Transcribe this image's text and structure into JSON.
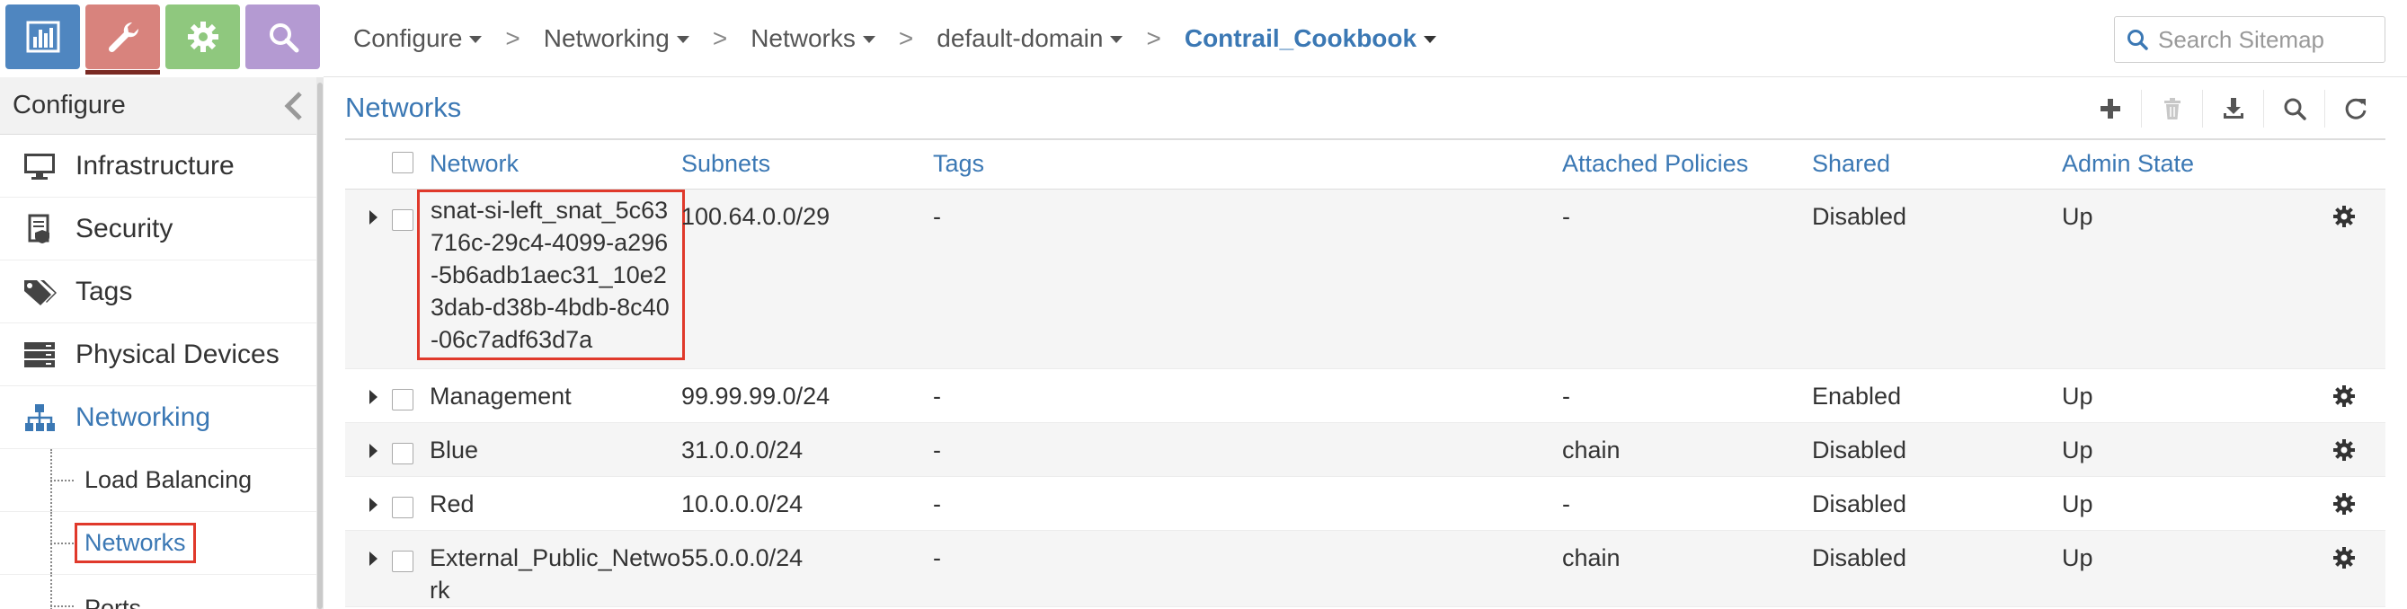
{
  "nav": {
    "tabs": [
      {
        "name": "monitor",
        "icon": "bar-chart-icon",
        "color": "#4f86c0"
      },
      {
        "name": "configure",
        "icon": "wrench-icon",
        "color": "#d8837d"
      },
      {
        "name": "settings",
        "icon": "gear-icon",
        "color": "#8fc87e"
      },
      {
        "name": "query",
        "icon": "search-icon",
        "color": "#b49ad2"
      }
    ]
  },
  "breadcrumb": [
    {
      "label": "Configure"
    },
    {
      "label": "Networking"
    },
    {
      "label": "Networks"
    },
    {
      "label": "default-domain"
    },
    {
      "label": "Contrail_Cookbook"
    }
  ],
  "search": {
    "placeholder": "Search Sitemap"
  },
  "sidebar": {
    "header": "Configure",
    "items": [
      {
        "label": "Infrastructure",
        "icon": "monitor-icon"
      },
      {
        "label": "Security",
        "icon": "security-doc-icon"
      },
      {
        "label": "Tags",
        "icon": "tags-icon"
      },
      {
        "label": "Physical Devices",
        "icon": "server-icon"
      },
      {
        "label": "Networking",
        "icon": "network-tree-icon"
      }
    ],
    "subitems": [
      {
        "label": "Load Balancing"
      },
      {
        "label": "Networks"
      },
      {
        "label": "Ports"
      }
    ]
  },
  "main": {
    "title": "Networks",
    "columns": [
      "Network",
      "Subnets",
      "Tags",
      "Attached Policies",
      "Shared",
      "Admin State"
    ],
    "rows": [
      {
        "network": "snat-si-left_snat_5c63716c-29c4-4099-a296-5b6adb1aec31_10e23dab-d38b-4bdb-8c40-06c7adf63d7a",
        "subnets": "100.64.0.0/29",
        "tags": "-",
        "policies": "-",
        "shared": "Disabled",
        "admin_state": "Up"
      },
      {
        "network": "Management",
        "subnets": "99.99.99.0/24",
        "tags": "-",
        "policies": "-",
        "shared": "Enabled",
        "admin_state": "Up"
      },
      {
        "network": "Blue",
        "subnets": "31.0.0.0/24",
        "tags": "-",
        "policies": "chain",
        "shared": "Disabled",
        "admin_state": "Up"
      },
      {
        "network": "Red",
        "subnets": "10.0.0.0/24",
        "tags": "-",
        "policies": "-",
        "shared": "Disabled",
        "admin_state": "Up"
      },
      {
        "network": "External_Public_Network",
        "subnets": "55.0.0.0/24",
        "tags": "-",
        "policies": "chain",
        "shared": "Disabled",
        "admin_state": "Up"
      }
    ]
  },
  "colors": {
    "accent": "#3b78b4",
    "highlight": "#e0392b"
  }
}
